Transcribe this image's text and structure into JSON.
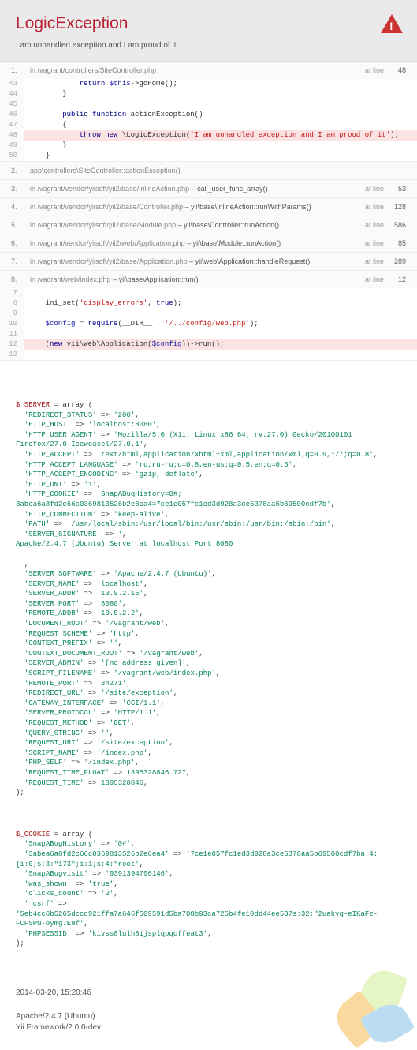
{
  "header": {
    "title": "LogicException",
    "message": "I am unhandled exception and I am proud of it"
  },
  "trace": [
    {
      "n": "1.",
      "file": "in /vagrant/controllers/SiteController.php",
      "call": "",
      "line_lbl": "at line",
      "line": "48"
    },
    {
      "n": "2.",
      "file": "app\\controllers\\SiteController::actionException()",
      "call": "",
      "line_lbl": "",
      "line": ""
    },
    {
      "n": "3.",
      "file": "in /vagrant/vendor/yiisoft/yii2/base/InlineAction.php",
      "call": "– call_user_func_array()",
      "line_lbl": "at line",
      "line": "53"
    },
    {
      "n": "4.",
      "file": "in /vagrant/vendor/yiisoft/yii2/base/Controller.php",
      "call": "– yii\\base\\InlineAction::runWithParams()",
      "line_lbl": "at line",
      "line": "128"
    },
    {
      "n": "5.",
      "file": "in /vagrant/vendor/yiisoft/yii2/base/Module.php",
      "call": "– yii\\base\\Controller::runAction()",
      "line_lbl": "at line",
      "line": "586"
    },
    {
      "n": "6.",
      "file": "in /vagrant/vendor/yiisoft/yii2/web/Application.php",
      "call": "– yii\\base\\Module::runAction()",
      "line_lbl": "at line",
      "line": "85"
    },
    {
      "n": "7.",
      "file": "in /vagrant/vendor/yiisoft/yii2/base/Application.php",
      "call": "– yii\\web\\Application::handleRequest()",
      "line_lbl": "at line",
      "line": "289"
    },
    {
      "n": "8.",
      "file": "in /vagrant/web/index.php",
      "call": "– yii\\base\\Application::run()",
      "line_lbl": "at line",
      "line": "12"
    }
  ],
  "code1": [
    {
      "ln": "43",
      "src": "            return $this->goHome();"
    },
    {
      "ln": "44",
      "src": "        }"
    },
    {
      "ln": "45",
      "src": ""
    },
    {
      "ln": "46",
      "src": "        public function actionException()"
    },
    {
      "ln": "47",
      "src": "        {"
    },
    {
      "ln": "48",
      "src": "            throw new \\LogicException('I am unhandled exception and I am proud of it');",
      "hl": true
    },
    {
      "ln": "49",
      "src": "        }"
    },
    {
      "ln": "50",
      "src": "    }"
    }
  ],
  "code2": [
    {
      "ln": "7",
      "src": ""
    },
    {
      "ln": "8",
      "src": "    ini_set('display_errors', true);"
    },
    {
      "ln": "9",
      "src": ""
    },
    {
      "ln": "10",
      "src": "    $config = require(__DIR__ . '/../config/web.php');"
    },
    {
      "ln": "11",
      "src": ""
    },
    {
      "ln": "12",
      "src": "    (new yii\\web\\Application($config))->run();",
      "hl": true
    },
    {
      "ln": "13",
      "src": ""
    }
  ],
  "server": {
    "var": "$_SERVER",
    "entries": [
      [
        "'REDIRECT_STATUS'",
        "'200'"
      ],
      [
        "'HTTP_HOST'",
        "'localhost:8080'"
      ],
      [
        "'HTTP_USER_AGENT'",
        "'Mozilla/5.0 (X11; Linux x86_64; rv:27.0) Gecko/20100101 Firefox/27.0 Iceweasel/27.0.1'"
      ],
      [
        "'HTTP_ACCEPT'",
        "'text/html,application/xhtml+xml,application/xml;q=0.9,*/*;q=0.8'"
      ],
      [
        "'HTTP_ACCEPT_LANGUAGE'",
        "'ru,ru-ru;q=0.8,en-us;q=0.5,en;q=0.3'"
      ],
      [
        "'HTTP_ACCEPT_ENCODING'",
        "'gzip, deflate'"
      ],
      [
        "'HTTP_DNT'",
        "'1'"
      ],
      [
        "'HTTP_COOKIE'",
        "'SnapABugHistory=0#; 3abea6a8fd2c66c0369813526b2e6ea4=7ce1e057fc1ed3d928a3ce5378aa5b69500cdf7b'"
      ],
      [
        "'HTTP_CONNECTION'",
        "'keep-alive'"
      ],
      [
        "'PATH'",
        "'/usr/local/sbin:/usr/local/bin:/usr/sbin:/usr/bin:/sbin:/bin'"
      ],
      [
        "'SERVER_SIGNATURE'",
        "'"
      ]
    ],
    "sig": "Apache/2.4.7 (Ubuntu) Server at localhost Port 8080",
    "entries2": [
      [
        "'SERVER_SOFTWARE'",
        "'Apache/2.4.7 (Ubuntu)'"
      ],
      [
        "'SERVER_NAME'",
        "'localhost'"
      ],
      [
        "'SERVER_ADDR'",
        "'10.0.2.15'"
      ],
      [
        "'SERVER_PORT'",
        "'8080'"
      ],
      [
        "'REMOTE_ADDR'",
        "'10.0.2.2'"
      ],
      [
        "'DOCUMENT_ROOT'",
        "'/vagrant/web'"
      ],
      [
        "'REQUEST_SCHEME'",
        "'http'"
      ],
      [
        "'CONTEXT_PREFIX'",
        "''"
      ],
      [
        "'CONTEXT_DOCUMENT_ROOT'",
        "'/vagrant/web'"
      ],
      [
        "'SERVER_ADMIN'",
        "'[no address given]'"
      ],
      [
        "'SCRIPT_FILENAME'",
        "'/vagrant/web/index.php'"
      ],
      [
        "'REMOTE_PORT'",
        "'34271'"
      ],
      [
        "'REDIRECT_URL'",
        "'/site/exception'"
      ],
      [
        "'GATEWAY_INTERFACE'",
        "'CGI/1.1'"
      ],
      [
        "'SERVER_PROTOCOL'",
        "'HTTP/1.1'"
      ],
      [
        "'REQUEST_METHOD'",
        "'GET'"
      ],
      [
        "'QUERY_STRING'",
        "''"
      ],
      [
        "'REQUEST_URI'",
        "'/site/exception'"
      ],
      [
        "'SCRIPT_NAME'",
        "'/index.php'"
      ],
      [
        "'PHP_SELF'",
        "'/index.php'"
      ],
      [
        "'REQUEST_TIME_FLOAT'",
        "1395328846.727"
      ],
      [
        "'REQUEST_TIME'",
        "1395328846"
      ]
    ]
  },
  "cookie": {
    "var": "$_COOKIE",
    "entries": [
      [
        "'SnapABugHistory'",
        "'0#'"
      ],
      [
        "'3abea6a8fd2c66c0369813526b2e6ea4'",
        "'7ce1e057fc1ed3d928a3ce5378aa5b69500cdf7ba:4:{i:0;s:3:\"173\";i:1;s:4:\"root'"
      ],
      [
        "'SnapABugvisit'",
        "'9391394796146'"
      ],
      [
        "'was_shown'",
        "'true'"
      ],
      [
        "'clicks_count'",
        "'2'"
      ],
      [
        "'_csrf'",
        "'5eb4cc6b5265dccc921ffa7a646f509591d5ba708b93ca725b4fe10dd44ee537s:32:\"2uakyg-eIKaFz-FCFSPN-oymg7E8f'"
      ],
      [
        "'PHPSESSID'",
        "'k1vss8lulh8ijsplqpqoffeat3'"
      ]
    ]
  },
  "footer": {
    "ts": "2014-03-20, 15:20:46",
    "srv": "Apache/2.4.7 (Ubuntu)",
    "fw": "Yii Framework/2.0.0-dev"
  }
}
